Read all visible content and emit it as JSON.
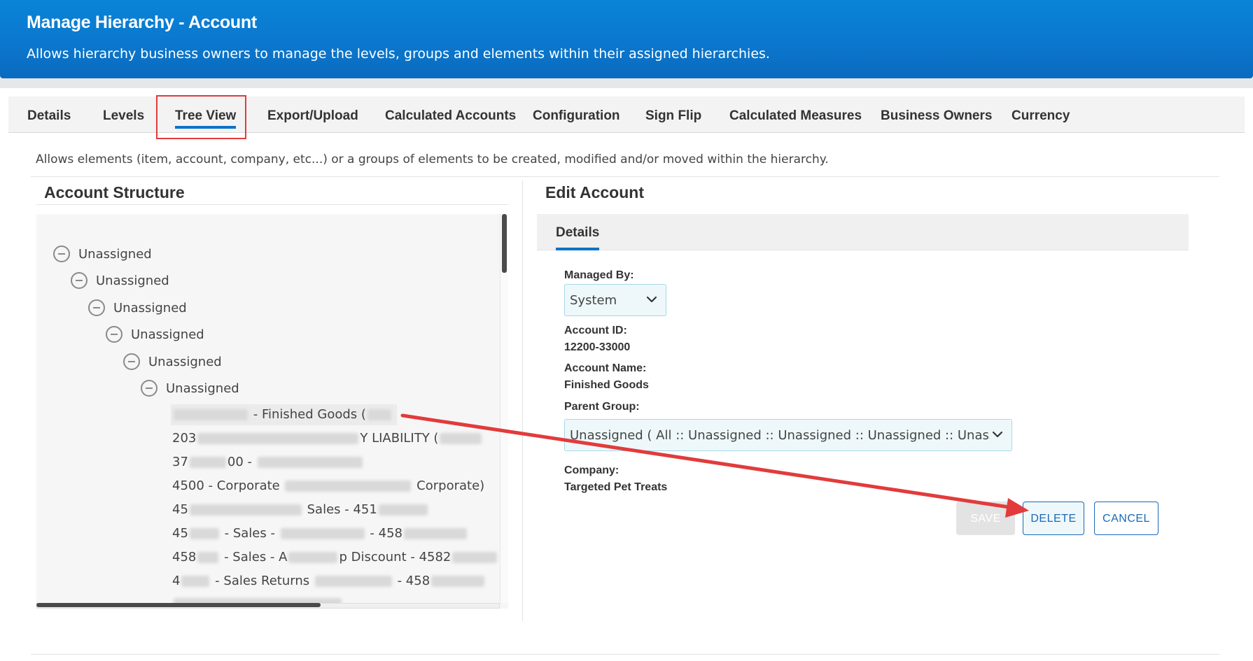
{
  "header": {
    "title": "Manage Hierarchy - Account",
    "subtitle": "Allows hierarchy business owners to manage the levels, groups and elements within their assigned hierarchies."
  },
  "tabs": [
    {
      "label": "Details",
      "active": false
    },
    {
      "label": "Levels",
      "active": false
    },
    {
      "label": "Tree View",
      "active": true
    },
    {
      "label": "Export/Upload",
      "active": false
    },
    {
      "label": "Calculated Accounts",
      "active": false
    },
    {
      "label": "Configuration",
      "active": false
    },
    {
      "label": "Sign Flip",
      "active": false
    },
    {
      "label": "Calculated Measures",
      "active": false
    },
    {
      "label": "Business Owners",
      "active": false
    },
    {
      "label": "Currency",
      "active": false
    }
  ],
  "page_description": "Allows elements (item, account, company, etc...) or a groups of elements to be created, modified and/or moved within the hierarchy.",
  "account_structure": {
    "title": "Account Structure",
    "tree_nodes": [
      {
        "label": "Unassigned"
      },
      {
        "label": "Unassigned"
      },
      {
        "label": "Unassigned"
      },
      {
        "label": "Unassigned"
      },
      {
        "label": "Unassigned"
      },
      {
        "label": "Unassigned"
      }
    ],
    "leaves": [
      {
        "pre": "",
        "mid": " - Finished Goods (",
        "post": ""
      },
      {
        "pre": "203",
        "mid": "Y LIABILITY (",
        "post": ""
      },
      {
        "pre": "37",
        "mid": "00 - ",
        "post": ""
      },
      {
        "pre": "45",
        "mid": "00 - Corporate ",
        "post": " Corporate)"
      },
      {
        "pre": "45",
        "mid": " Sales - 451",
        "post": ""
      },
      {
        "pre": "45",
        "mid": " - Sales - ",
        "post": " - 458"
      },
      {
        "pre": "458",
        "mid": " - Sales - A",
        "post": "p Discount - 4582"
      },
      {
        "pre": "4",
        "mid": " - Sales Returns ",
        "post": " - 458"
      }
    ]
  },
  "edit_account": {
    "title": "Edit Account",
    "details_tab": "Details",
    "managed_by_label": "Managed By:",
    "managed_by_value": "System",
    "account_id_label": "Account ID:",
    "account_id_value": "12200-33000",
    "account_name_label": "Account Name:",
    "account_name_value": "Finished Goods",
    "parent_group_label": "Parent Group:",
    "parent_group_value": "Unassigned ( All :: Unassigned :: Unassigned :: Unassigned :: Unassigned :: ",
    "company_label": "Company:",
    "company_value": "Targeted Pet Treats",
    "buttons": {
      "save": "SAVE",
      "delete": "DELETE",
      "cancel": "CANCEL"
    }
  },
  "colors": {
    "header_blue": "#0b76cc",
    "accent_blue": "#0b73c9",
    "button_blue": "#1a69b8",
    "annotation_red": "#e23b3b"
  }
}
